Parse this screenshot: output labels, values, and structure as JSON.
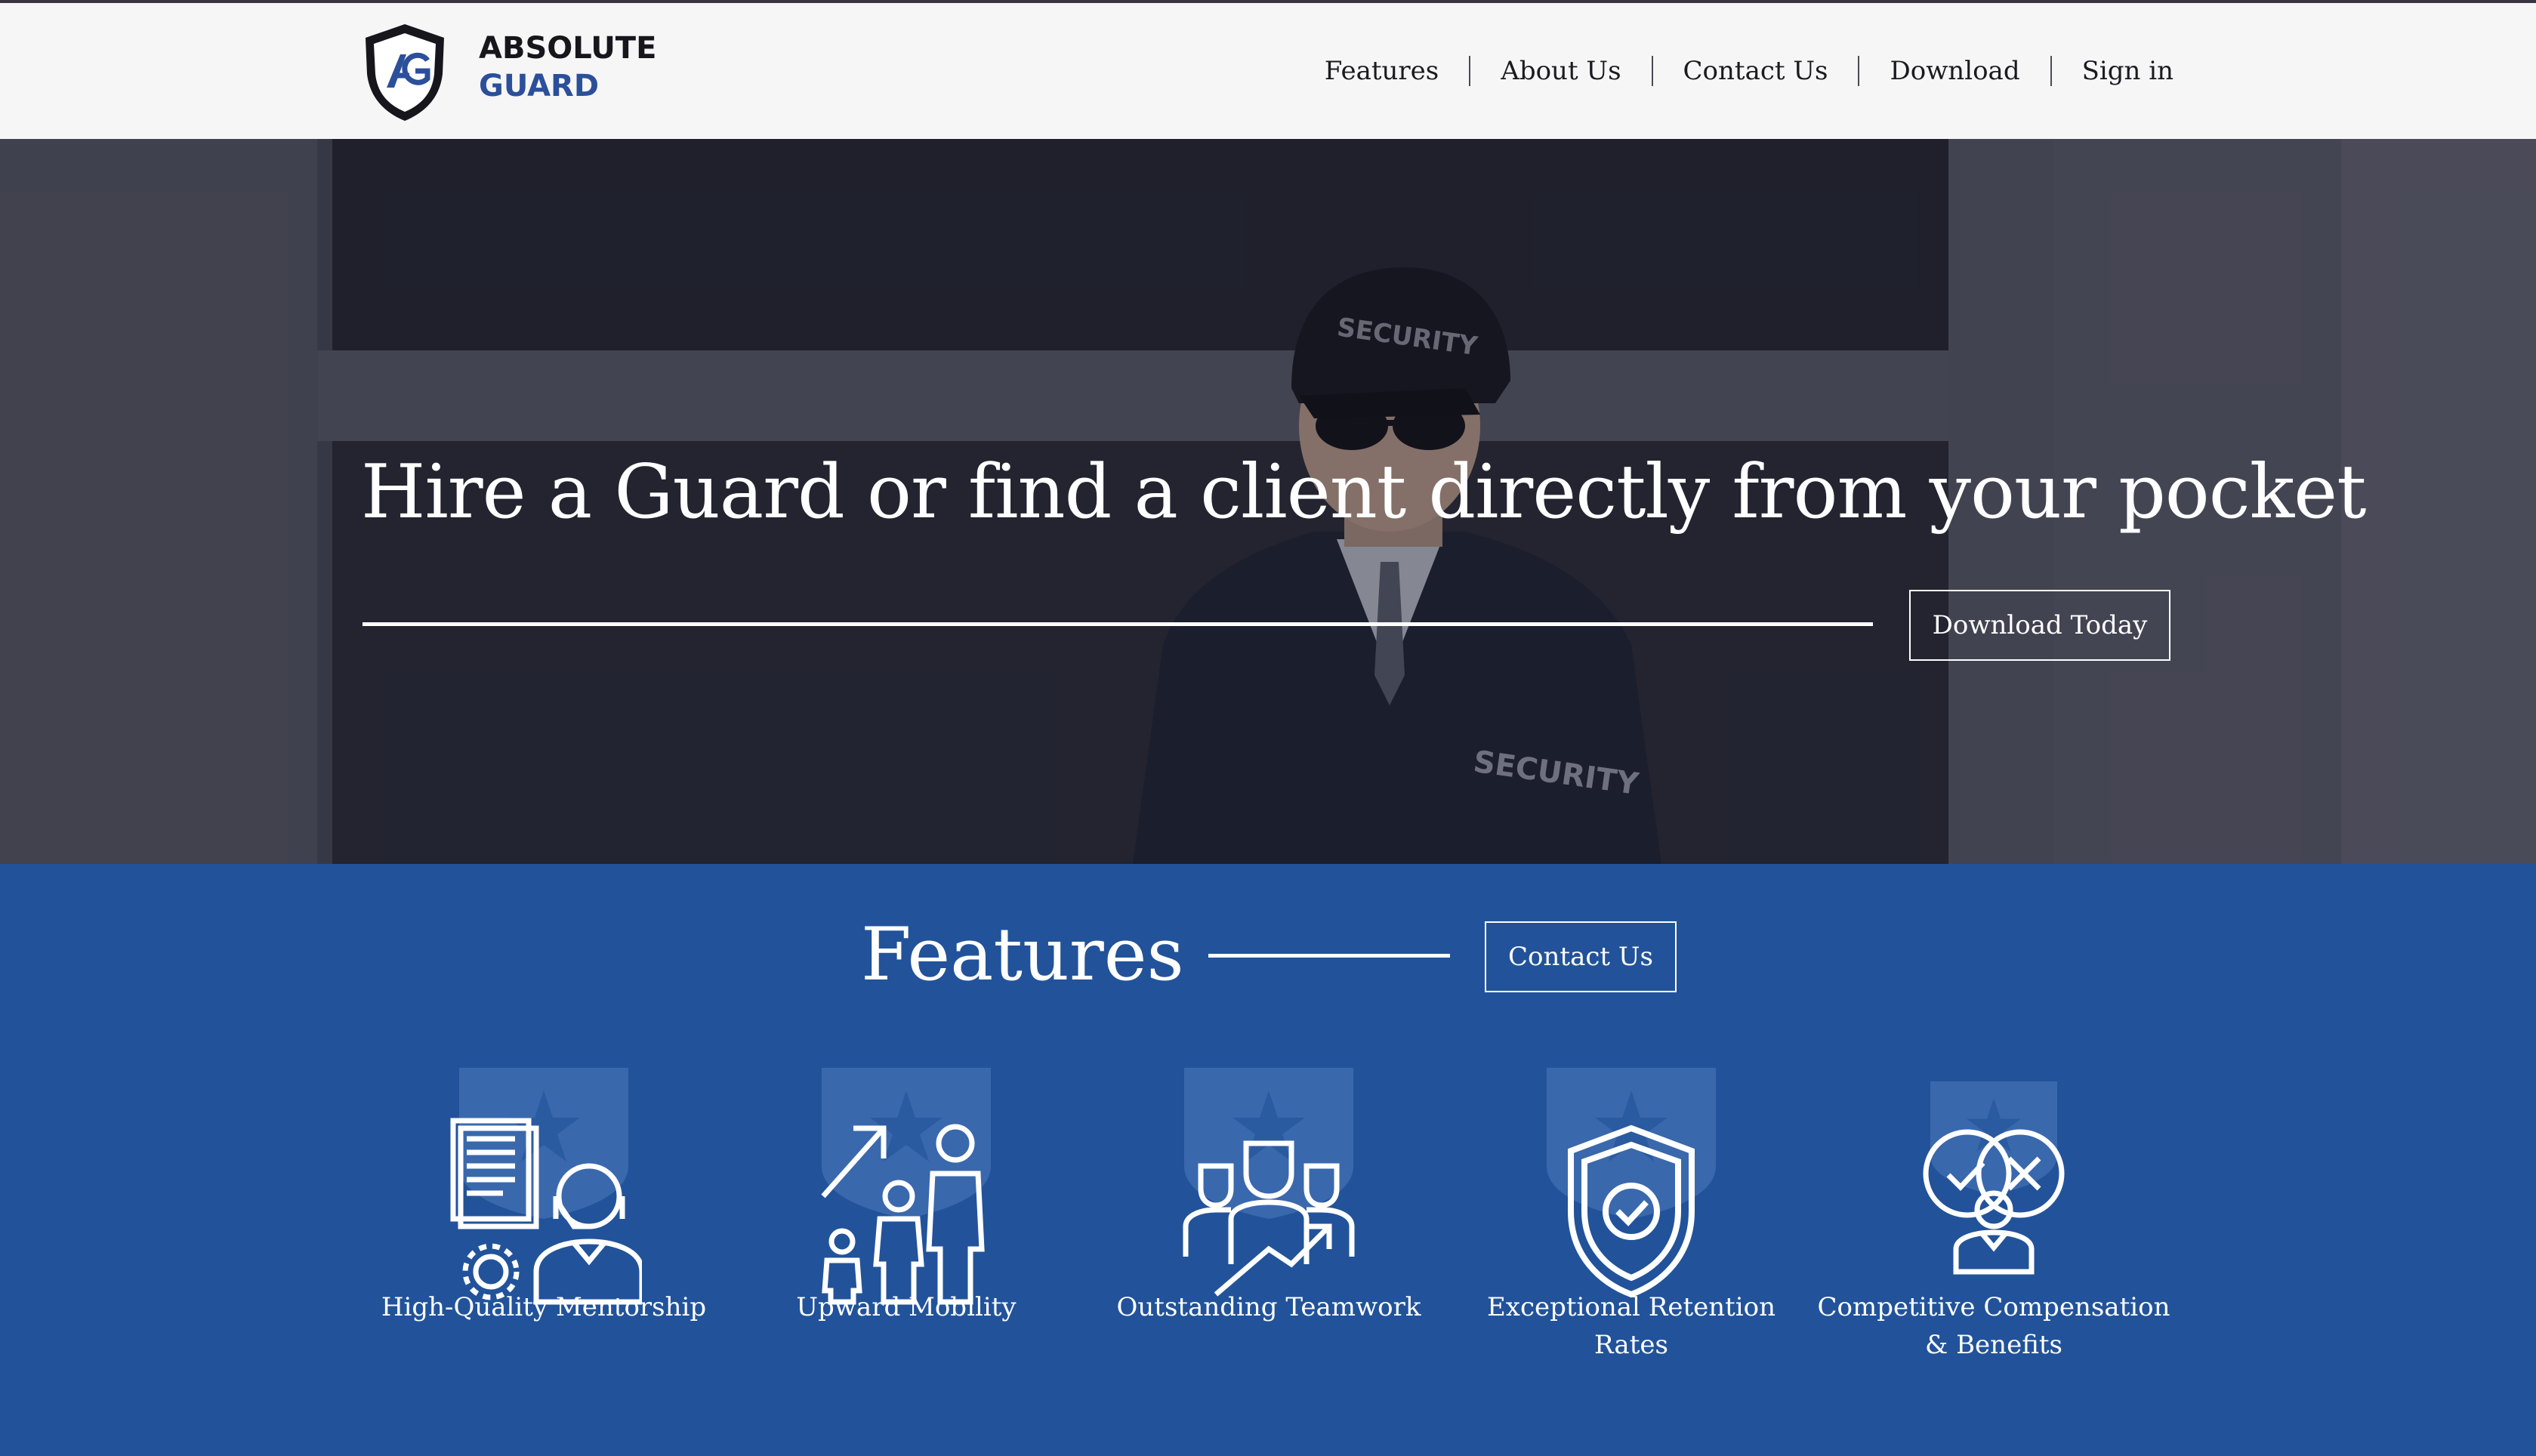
{
  "brand": {
    "name_line1": "ABSOLUTE",
    "name_line2": "GUARD",
    "mark": "AG"
  },
  "nav": {
    "items": [
      "Features",
      "About Us",
      "Contact Us",
      "Download",
      "Sign in"
    ]
  },
  "hero": {
    "headline": "Hire a Guard or find a client directly from your pocket",
    "cta_label": "Download Today"
  },
  "features": {
    "title": "Features",
    "cta_label": "Contact Us",
    "items": [
      {
        "label": "High-Quality Mentorship",
        "icon": "mentorship-icon"
      },
      {
        "label": "Upward Mobility",
        "icon": "upward-mobility-icon"
      },
      {
        "label": "Outstanding Teamwork",
        "icon": "teamwork-icon"
      },
      {
        "label": "Exceptional Retention Rates",
        "icon": "shield-check-icon"
      },
      {
        "label": "Competitive Compensation & Benefits",
        "icon": "decision-icon"
      }
    ]
  },
  "colors": {
    "brand_blue": "#2b4f9a",
    "features_bg": "#22539a",
    "navbar_bg": "#f6f6f7"
  }
}
